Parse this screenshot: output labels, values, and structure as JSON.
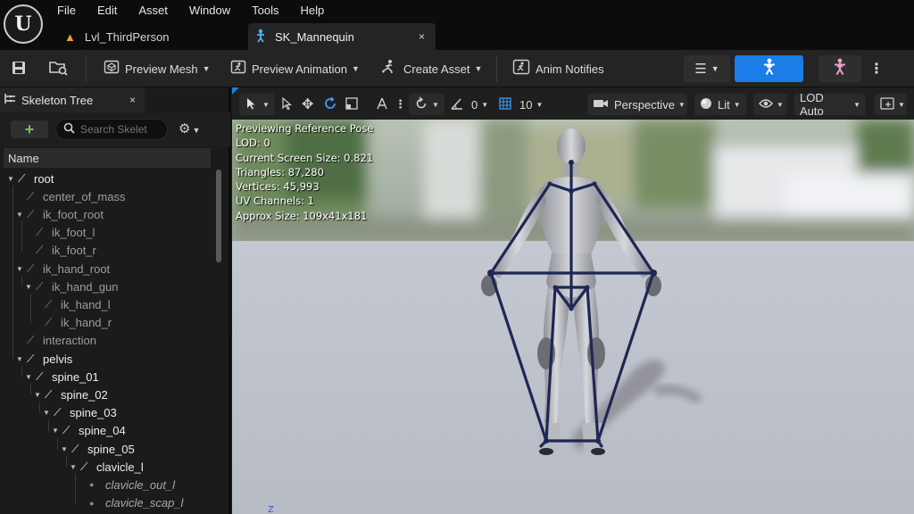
{
  "menu": {
    "logo": "U",
    "items": [
      "File",
      "Edit",
      "Asset",
      "Window",
      "Tools",
      "Help"
    ]
  },
  "tabs": [
    {
      "label": "Lvl_ThirdPerson",
      "icon": "level-icon"
    },
    {
      "label": "SK_Mannequin",
      "icon": "skeletal-mesh-icon",
      "close": "×"
    }
  ],
  "toolbar": {
    "preview_mesh": "Preview Mesh",
    "preview_animation": "Preview Animation",
    "create_asset": "Create Asset",
    "anim_notifies": "Anim Notifies"
  },
  "skeleton_tree": {
    "title": "Skeleton Tree",
    "close": "×",
    "search_placeholder": "Search Skelet",
    "column_name": "Name",
    "bones": [
      {
        "name": "root",
        "depth": 0,
        "style": "solid"
      },
      {
        "name": "center_of_mass",
        "depth": 1,
        "style": "faded"
      },
      {
        "name": "ik_foot_root",
        "depth": 1,
        "style": "faded"
      },
      {
        "name": "ik_foot_l",
        "depth": 2,
        "style": "faded"
      },
      {
        "name": "ik_foot_r",
        "depth": 2,
        "style": "faded"
      },
      {
        "name": "ik_hand_root",
        "depth": 1,
        "style": "faded"
      },
      {
        "name": "ik_hand_gun",
        "depth": 2,
        "style": "faded"
      },
      {
        "name": "ik_hand_l",
        "depth": 3,
        "style": "faded"
      },
      {
        "name": "ik_hand_r",
        "depth": 3,
        "style": "faded"
      },
      {
        "name": "interaction",
        "depth": 1,
        "style": "faded"
      },
      {
        "name": "pelvis",
        "depth": 1,
        "style": "solid"
      },
      {
        "name": "spine_01",
        "depth": 2,
        "style": "solid"
      },
      {
        "name": "spine_02",
        "depth": 3,
        "style": "solid"
      },
      {
        "name": "spine_03",
        "depth": 4,
        "style": "solid"
      },
      {
        "name": "spine_04",
        "depth": 5,
        "style": "solid"
      },
      {
        "name": "spine_05",
        "depth": 6,
        "style": "solid"
      },
      {
        "name": "clavicle_l",
        "depth": 7,
        "style": "solid"
      },
      {
        "name": "clavicle_out_l",
        "depth": 8,
        "style": "socket"
      },
      {
        "name": "clavicle_scap_l",
        "depth": 8,
        "style": "socket"
      }
    ]
  },
  "viewport": {
    "rotate_snap": "0",
    "grid_snap": "10",
    "view_mode": "Perspective",
    "lighting": "Lit",
    "lod": "LOD Auto",
    "stats": [
      "Previewing Reference Pose",
      "LOD: 0",
      "Current Screen Size: 0.821",
      "Triangles: 87,280",
      "Vertices: 45,993",
      "UV Channels: 1",
      "Approx Size: 109x41x181"
    ]
  },
  "colors": {
    "accent_blue": "#1a7de8",
    "pink_skeleton": "#e8a0c8",
    "add_green": "#6cc44a"
  }
}
